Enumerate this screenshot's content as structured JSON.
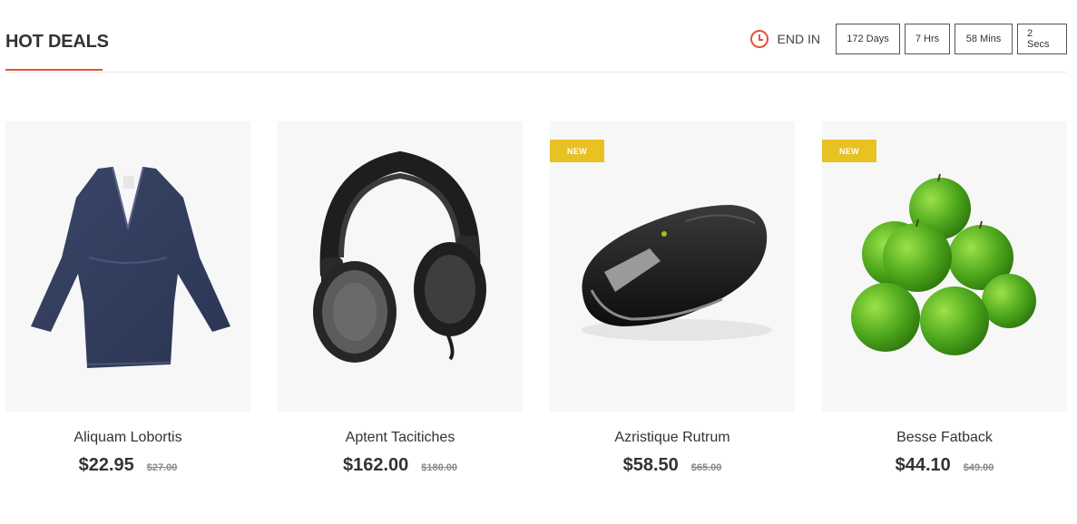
{
  "section": {
    "title": "HOT DEALS"
  },
  "countdown": {
    "label": "END IN",
    "days": "172 Days",
    "hours": "7 Hrs",
    "minutes": "58 Mins",
    "seconds": "2 Secs"
  },
  "colors": {
    "accent": "#e0533d",
    "badge": "#e8c123",
    "thumb_bg": "#f7f7f7"
  },
  "products": [
    {
      "name": "Aliquam Lobortis",
      "price": "$22.95",
      "old_price": "$27.00",
      "badge": "",
      "image": "dress-image"
    },
    {
      "name": "Aptent Tacitiches",
      "price": "$162.00",
      "old_price": "$180.00",
      "badge": "",
      "image": "headphones-image"
    },
    {
      "name": "Azristique Rutrum",
      "price": "$58.50",
      "old_price": "$65.00",
      "badge": "NEW",
      "image": "mouse-image"
    },
    {
      "name": "Besse Fatback",
      "price": "$44.10",
      "old_price": "$49.00",
      "badge": "NEW",
      "image": "apples-image"
    }
  ]
}
